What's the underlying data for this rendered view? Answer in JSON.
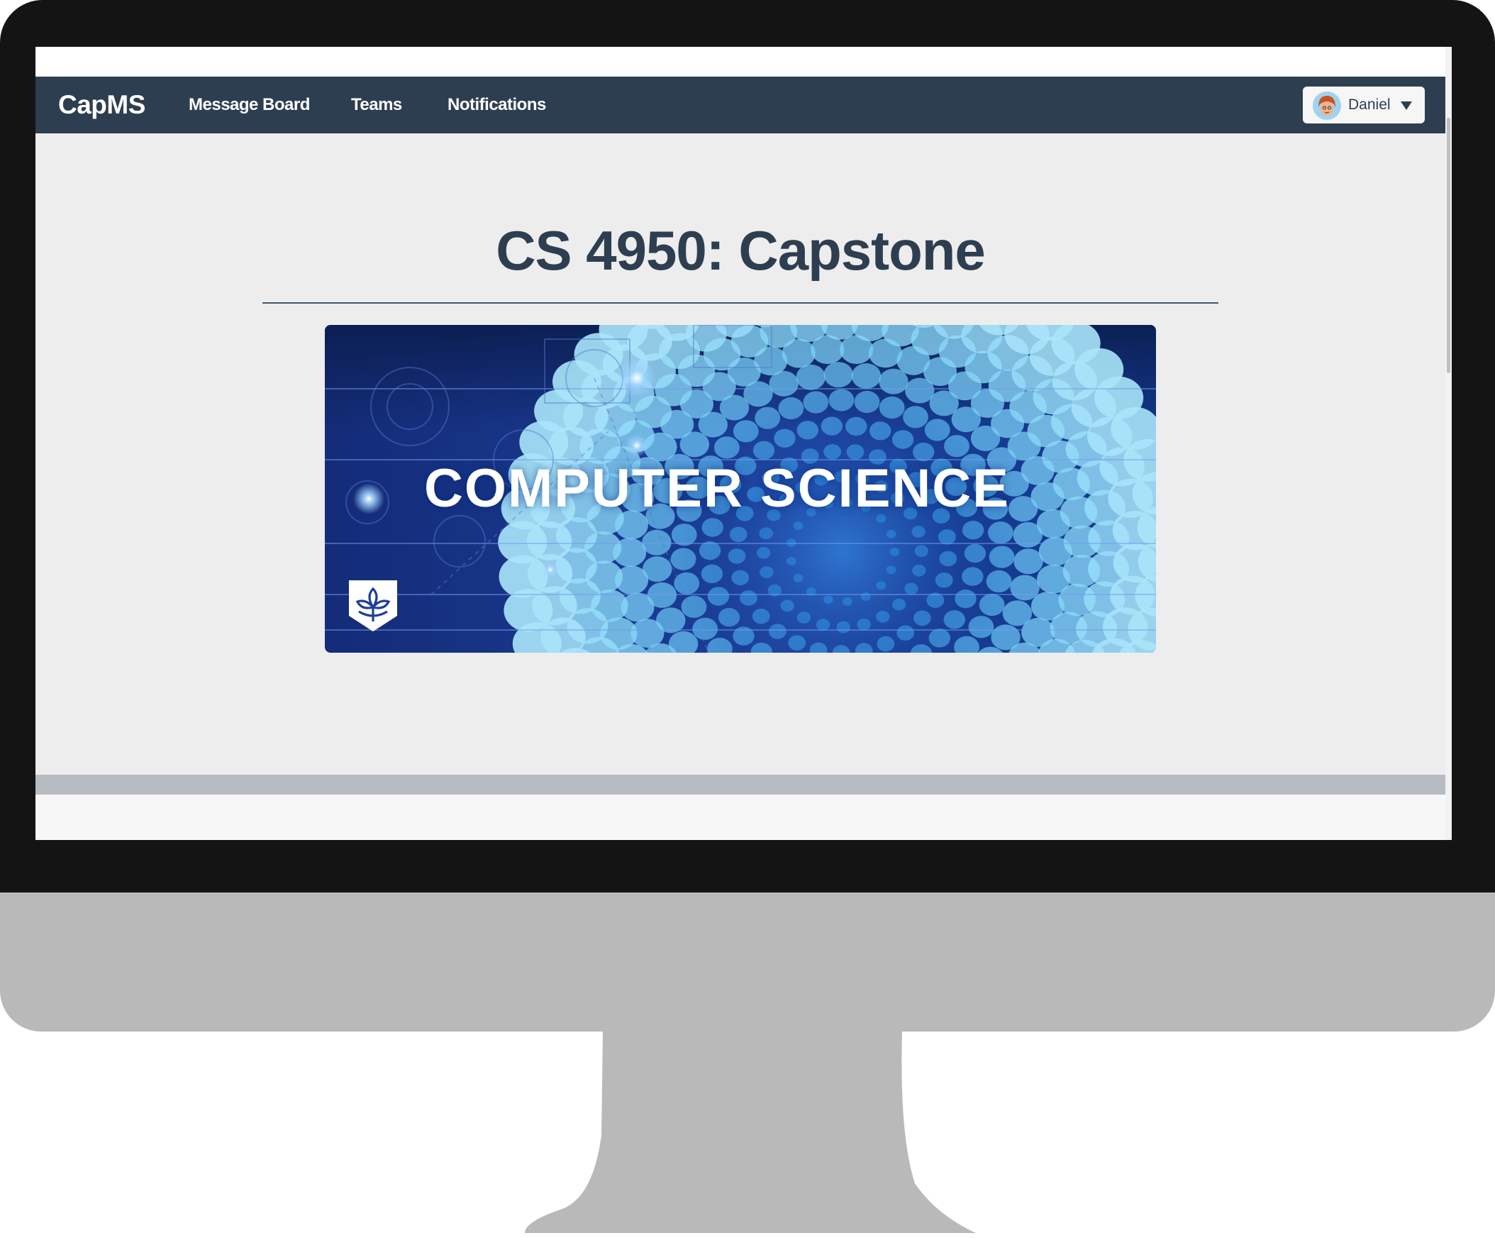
{
  "navbar": {
    "brand": "CapMS",
    "links": [
      {
        "label": "Message Board"
      },
      {
        "label": "Teams"
      },
      {
        "label": "Notifications"
      }
    ],
    "user": {
      "name": "Daniel",
      "avatar_icon": "user-avatar-icon",
      "menu_icon": "caret-down-icon"
    }
  },
  "main": {
    "title": "CS 4950: Capstone",
    "banner": {
      "text": "COMPUTER SCIENCE",
      "logo_icon": "shield-leaf-logo-icon"
    }
  },
  "colors": {
    "navbar": "#2e3e51",
    "content_bg": "#ededed",
    "banner_blue": "#1b3f9a",
    "footer_bar": "#b6bcc2"
  }
}
